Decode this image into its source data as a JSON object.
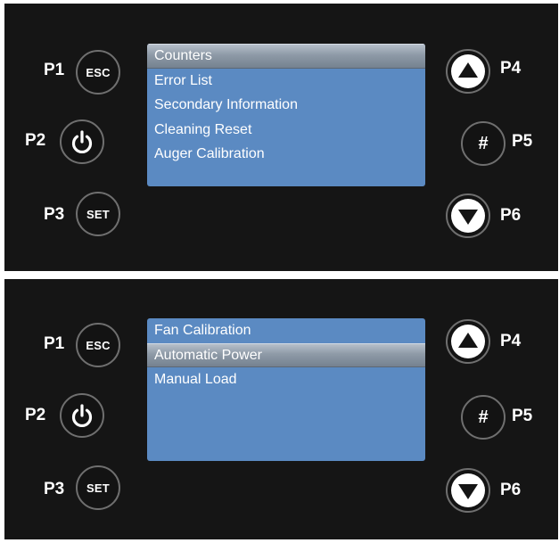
{
  "panels": [
    {
      "labels": [
        "P1",
        "P2",
        "P3",
        "P4",
        "P5",
        "P6"
      ],
      "buttons": {
        "esc": "ESC",
        "set": "SET",
        "hash": "#",
        "power_icon": "power-icon",
        "up_icon": "up-arrow-icon",
        "down_icon": "down-arrow-icon"
      },
      "menu": {
        "items": [
          "Counters",
          "Error List",
          "Secondary Information",
          "Cleaning Reset",
          "Auger Calibration"
        ],
        "selected_index": 0
      }
    },
    {
      "labels": [
        "P1",
        "P2",
        "P3",
        "P4",
        "P5",
        "P6"
      ],
      "buttons": {
        "esc": "ESC",
        "set": "SET",
        "hash": "#",
        "power_icon": "power-icon",
        "up_icon": "up-arrow-icon",
        "down_icon": "down-arrow-icon"
      },
      "menu": {
        "items": [
          "Fan Calibration",
          "Automatic Power",
          "Manual Load"
        ],
        "selected_index": 1
      }
    }
  ],
  "colors": {
    "panel_background": "#151515",
    "screen_background": "#5b8ac2",
    "selection_highlight": "#9aa5b1",
    "button_ring": "#6f6f6f",
    "text": "#ffffff"
  }
}
